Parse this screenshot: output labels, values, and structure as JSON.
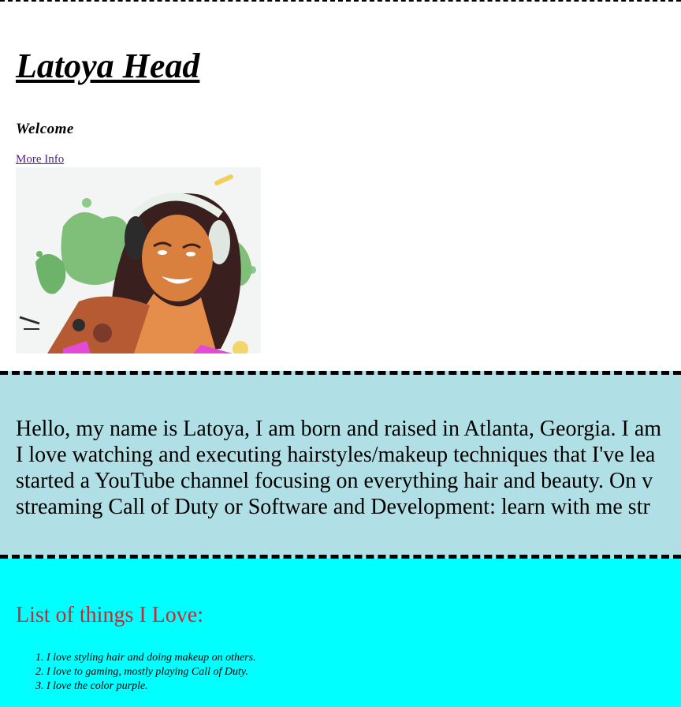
{
  "header": {
    "title": "Latoya Head",
    "welcome": "Welcome",
    "more_info_link": "More Info"
  },
  "bio": {
    "lines": [
      "Hello, my name is Latoya, I am born and raised in Atlanta, Georgia. I am",
      "I love watching and executing hairstyles/makeup techniques that I've lea",
      "started a YouTube channel focusing on everything hair and beauty. On v",
      "streaming Call of Duty or Software and Development: learn with me str"
    ]
  },
  "loves": {
    "heading": "List of things I Love:",
    "items": [
      "I love styling hair and doing makeup on others.",
      "I love to gaming, mostly playing Call of Duty.",
      "I love the color purple."
    ]
  },
  "colors": {
    "bio_background": "#b0dfe5",
    "loves_background": "#00ffff",
    "loves_heading": "#d4232e",
    "link_visited": "#551a8b"
  }
}
